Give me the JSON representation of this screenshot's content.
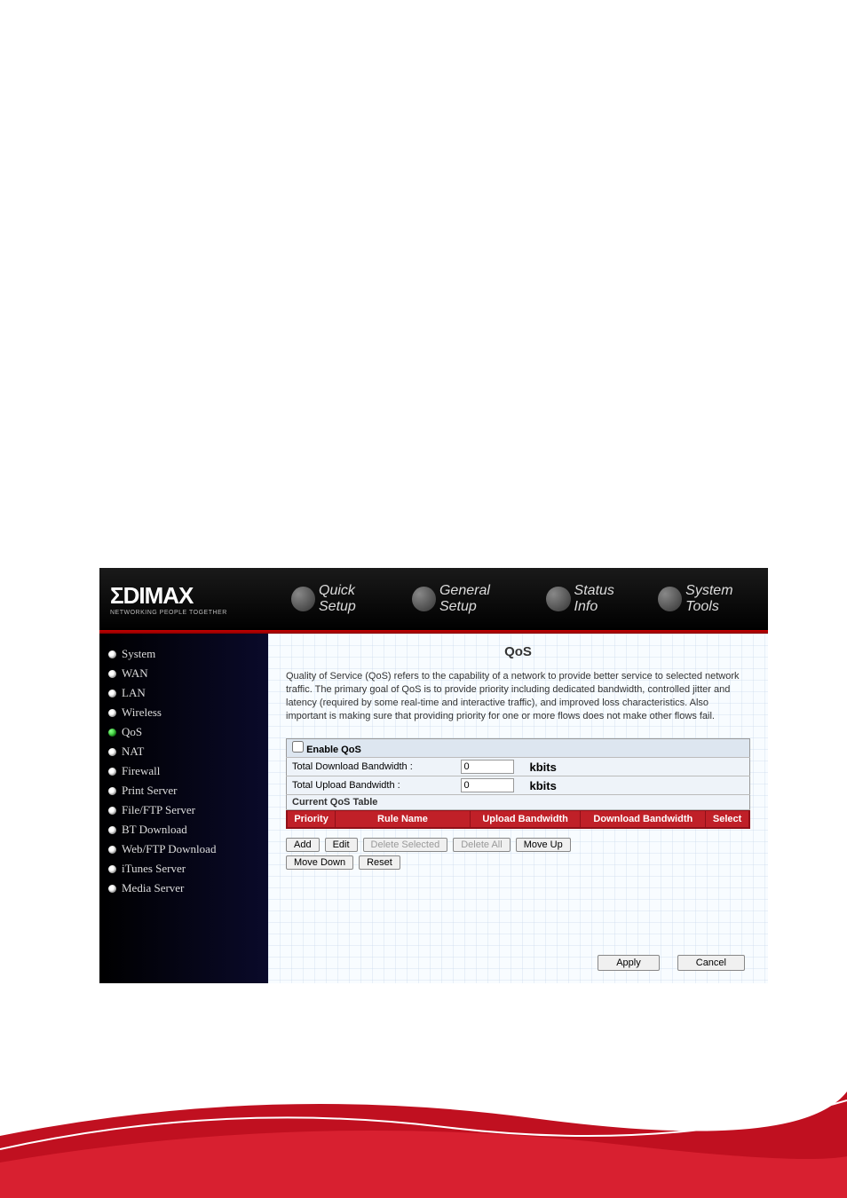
{
  "logo": {
    "main": "ΣDIMAX",
    "tagline": "NETWORKING PEOPLE TOGETHER"
  },
  "nav": {
    "quick_setup": "Quick Setup",
    "general_setup": "General Setup",
    "status_info": "Status Info",
    "system_tools": "System Tools"
  },
  "sidebar": {
    "items": [
      {
        "label": "System"
      },
      {
        "label": "WAN"
      },
      {
        "label": "LAN"
      },
      {
        "label": "Wireless"
      },
      {
        "label": "QoS"
      },
      {
        "label": "NAT"
      },
      {
        "label": "Firewall"
      },
      {
        "label": "Print Server"
      },
      {
        "label": "File/FTP Server"
      },
      {
        "label": "BT Download"
      },
      {
        "label": "Web/FTP Download"
      },
      {
        "label": "iTunes Server"
      },
      {
        "label": "Media Server"
      }
    ]
  },
  "main": {
    "title": "QoS",
    "description": "Quality of Service (QoS) refers to the capability of a network to provide better service to selected network traffic. The primary goal of QoS is to provide priority including dedicated bandwidth, controlled jitter and latency (required by some real-time and interactive traffic), and improved loss characteristics. Also important is making sure that providing priority for one or more flows does not make other flows fail.",
    "enable_label": "Enable QoS",
    "download_label": "Total Download Bandwidth :",
    "download_value": "0",
    "upload_label": "Total Upload Bandwidth :",
    "upload_value": "0",
    "unit": "kbits",
    "current_table_label": "Current QoS Table",
    "columns": {
      "priority": "Priority",
      "rule_name": "Rule Name",
      "upload": "Upload Bandwidth",
      "download": "Download Bandwidth",
      "select": "Select"
    },
    "buttons": {
      "add": "Add",
      "edit": "Edit",
      "delete_selected": "Delete Selected",
      "delete_all": "Delete All",
      "move_up": "Move Up",
      "move_down": "Move Down",
      "reset": "Reset",
      "apply": "Apply",
      "cancel": "Cancel"
    }
  }
}
